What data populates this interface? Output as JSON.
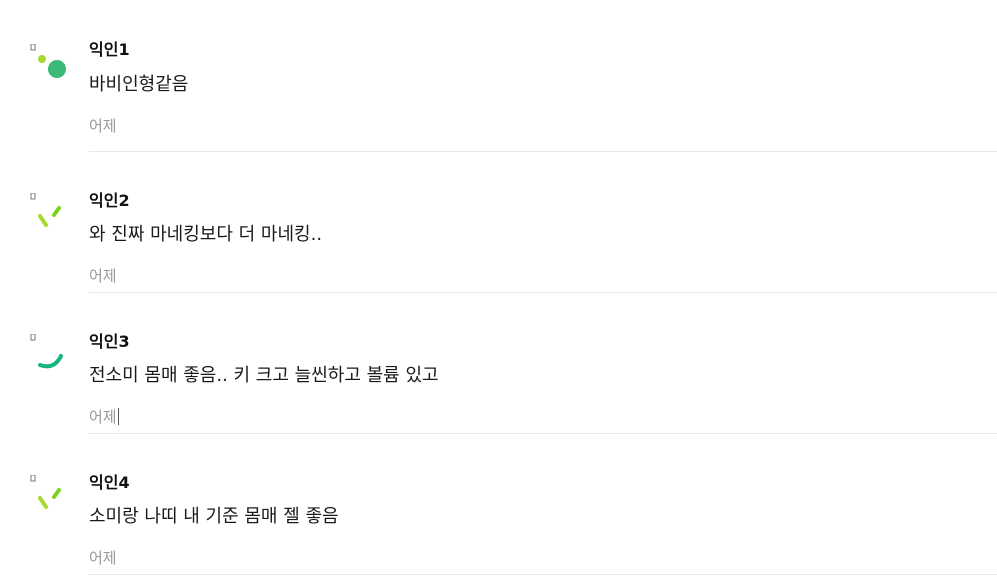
{
  "colors": {
    "author": "#111111",
    "text": "#1a1a1a",
    "time": "#9a9a9a",
    "divider": "#e9e9e9",
    "avatar_green": "#3cb878",
    "avatar_lime": "#a6d82f",
    "avatar_teal": "#16b57f"
  },
  "comments": [
    {
      "author": "익인1",
      "text": "바비인형같음",
      "time": "어제",
      "avatar_icon": "loading-dots-icon"
    },
    {
      "author": "익인2",
      "text": "와 진짜 마네킹보다 더 마네킹..",
      "time": "어제",
      "avatar_icon": "loading-dashes-icon"
    },
    {
      "author": "익인3",
      "text": "전소미 몸매 좋음.. 키 크고 늘씬하고 볼륨 있고",
      "time": "어제",
      "avatar_icon": "loading-arc-icon"
    },
    {
      "author": "익인4",
      "text": "소미랑 나띠 내 기준 몸매 젤 좋음",
      "time": "어제",
      "avatar_icon": "loading-dashes-icon"
    }
  ]
}
